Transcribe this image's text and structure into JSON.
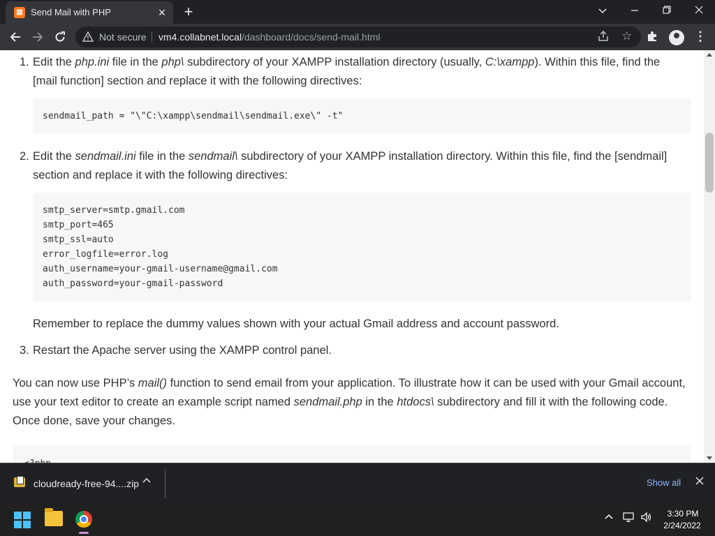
{
  "tab": {
    "title": "Send Mail with PHP",
    "favicon": "xampp-icon"
  },
  "toolbar": {
    "security_text": "Not secure",
    "url_host": "vm4.collabnet.local",
    "url_path": "/dashboard/docs/send-mail.html"
  },
  "content": {
    "step1": {
      "num": "1.",
      "t1": "Edit the ",
      "e1": "php.ini",
      "t2": " file in the ",
      "e2": "php\\",
      "t3": " subdirectory of your XAMPP installation directory (usually, ",
      "e3": "C:\\xampp",
      "t4": "). Within this file, find the [mail function] section and replace it with the following directives:",
      "code": "sendmail_path = \"\\\"C:\\xampp\\sendmail\\sendmail.exe\\\" -t\""
    },
    "step2": {
      "num": "2.",
      "t1": "Edit the ",
      "e1": "sendmail.ini",
      "t2": " file in the ",
      "e2": "sendmail\\",
      "t3": " subdirectory of your XAMPP installation directory. Within this file, find the [sendmail] section and replace it with the following directives:",
      "code": "smtp_server=smtp.gmail.com\nsmtp_port=465\nsmtp_ssl=auto\nerror_logfile=error.log\nauth_username=your-gmail-username@gmail.com\nauth_password=your-gmail-password",
      "note": "Remember to replace the dummy values shown with your actual Gmail address and account password."
    },
    "step3": {
      "num": "3.",
      "text": "Restart the Apache server using the XAMPP control panel."
    },
    "para": {
      "t1": "You can now use PHP’s ",
      "e1": "mail()",
      "t2": " function to send email from your application. To illustrate how it can be used with your Gmail account, use your text editor to create an example script named ",
      "e2": "sendmail.php",
      "t3": " in the ",
      "e3": "htdocs\\",
      "t4": " subdirectory and fill it with the following code. Once done, save your changes."
    },
    "code3_partial": "<?php"
  },
  "download": {
    "filename": "cloudready-free-94....zip",
    "show_all": "Show all"
  },
  "taskbar": {
    "time": "3:30 PM",
    "date": "2/24/2022"
  }
}
